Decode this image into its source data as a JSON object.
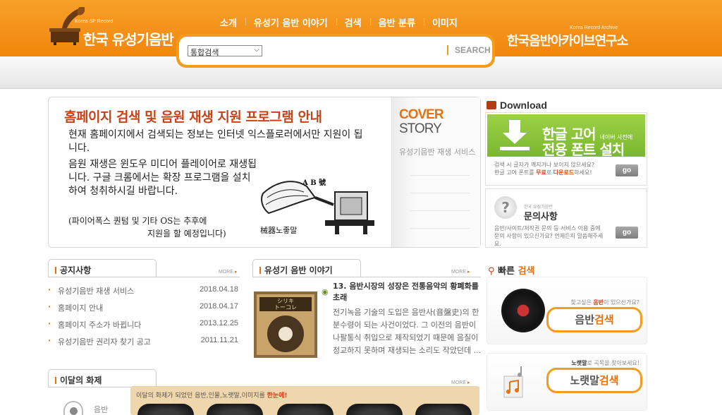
{
  "header": {
    "logo_sub": "Korea SP Record",
    "logo_title": "한국 유성기음반",
    "nav": [
      "소개",
      "유성기 음반 이야기",
      "검색",
      "음반 분류",
      "이미지"
    ],
    "search": {
      "select_value": "통합검색",
      "input_value": "",
      "button_label": "SEARCH"
    },
    "archive_sub": "Korea Record Archive",
    "archive_title": "한국음반아카이브연구소"
  },
  "banner": {
    "title": "홈페이지 검색 및 음원 재생 지원 프로그램 안내",
    "p1": "현재 홈페이지에서 검색되는 정보는 인터넷 익스플로러에서만 지원이 됩니다.",
    "p2": "음원 재생은 윈도우 미디어 플레이어로 재생됩니다. 구글 크롬에서는 확장 프로그램을 설치하여 청취하시길 바랍니다.",
    "p3a": "(파이어폭스 퀀텀 및 기타 OS는 추후에",
    "p3b": "지원을 할 예정입니다)",
    "img_label_top": "A B 號",
    "img_label_bottom": "械器노좋말",
    "side": {
      "cover": "COVER",
      "story": "STORY",
      "item": "유성기음반 재생 서비스"
    }
  },
  "download": {
    "heading": "Download",
    "t1": "한글 고어",
    "t1_small": "네이버 사전에",
    "t2": "전용 폰트 설치",
    "note_a": "검색 시 글자가 깨지거나 보이지 않으세요?",
    "note_b1": "한글 고어 폰트를 ",
    "note_b_free": "무료",
    "note_b2": "로 ",
    "note_b_dl": "다운로드",
    "note_b3": "하세요!",
    "go": "go"
  },
  "qa": {
    "sub": "한국 유성기음반",
    "title": "문의사항",
    "note_a": "음반/사이트/저작권 문의 등 서비스 이용 중에",
    "note_b": "문의 사항이 있으신가요? 언제든지 말씀해주세요.",
    "go": "go"
  },
  "quick_search": {
    "heading_a": "빠른",
    "heading_b": "검색",
    "hint1_a": "찾고싶은 ",
    "hint1_b": "음반",
    "hint1_c": "이 있으신가요?",
    "btn1_a": "음반",
    "btn1_b": "검색",
    "hint2_a": "노랫말",
    "hint2_b": "로 곡목을 찾아보세요!",
    "btn2_a": "노랫말",
    "btn2_b": "검색"
  },
  "notice": {
    "title": "공지사항",
    "more": "MORE",
    "items": [
      {
        "title": "유성기음반 재생 서비스",
        "date": "2018.04.18"
      },
      {
        "title": "홈페이지 안내",
        "date": "2018.04.17"
      },
      {
        "title": "홈페이지 주소가 바뀝니다",
        "date": "2013.12.25"
      },
      {
        "title": "유성기음반 권리자 찾기 공고",
        "date": "2011.11.21"
      }
    ]
  },
  "story": {
    "title": "유성기 음반 이야기",
    "more": "MORE",
    "img_label": "シリキ\nトーコレ",
    "headline": "13. 음반시장의 성장은 전통음악의 황폐화를 초래",
    "body": "전기녹음 기술의 도입은 음반사(音盤史)의 한 분수령이 되는 사건이었다. 그 이전의 음반이 나팔통식 취입으로 제작되었기 때문에 음질이 정교하지 못하며 재생되는 소리도 작았던데 ..."
  },
  "topic": {
    "title": "이달의 화제",
    "more": "MORE",
    "text_a": "이달의 화제가 되었던  음반,인물,노랫말,이미지를 ",
    "text_b": "한눈에!",
    "side_label": "음반"
  }
}
